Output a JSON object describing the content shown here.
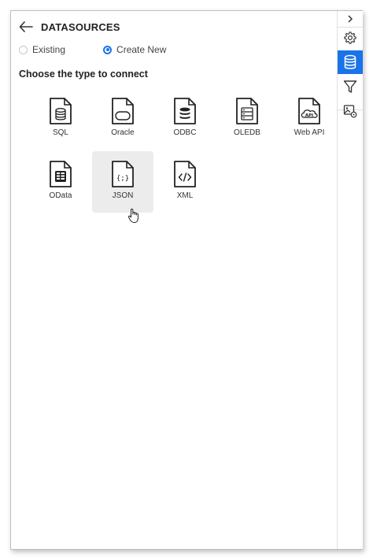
{
  "header": {
    "title": "DATASOURCES",
    "back_icon": "arrow-left-icon"
  },
  "radios": {
    "existing_label": "Existing",
    "create_new_label": "Create New",
    "selected": "create_new"
  },
  "section_title": "Choose the type to connect",
  "datasources": [
    {
      "label": "SQL",
      "icon": "database-file-icon"
    },
    {
      "label": "Oracle",
      "icon": "oracle-file-icon"
    },
    {
      "label": "ODBC",
      "icon": "odbc-file-icon"
    },
    {
      "label": "OLEDB",
      "icon": "oledb-file-icon"
    },
    {
      "label": "Web API",
      "icon": "web-api-file-icon"
    },
    {
      "label": "OData",
      "icon": "odata-file-icon"
    },
    {
      "label": "JSON",
      "icon": "json-file-icon"
    },
    {
      "label": "XML",
      "icon": "xml-file-icon"
    }
  ],
  "hovered_item": "JSON",
  "side_rail": {
    "collapse_icon": "chevron-right-icon",
    "items": [
      {
        "icon": "gear-icon",
        "active": false
      },
      {
        "icon": "database-icon",
        "active": true
      },
      {
        "icon": "filter-icon",
        "active": false
      },
      {
        "icon": "image-settings-icon",
        "active": false
      }
    ]
  },
  "colors": {
    "accent": "#1a73e8",
    "hover_bg": "#ececec",
    "border": "#bdbdbd"
  }
}
